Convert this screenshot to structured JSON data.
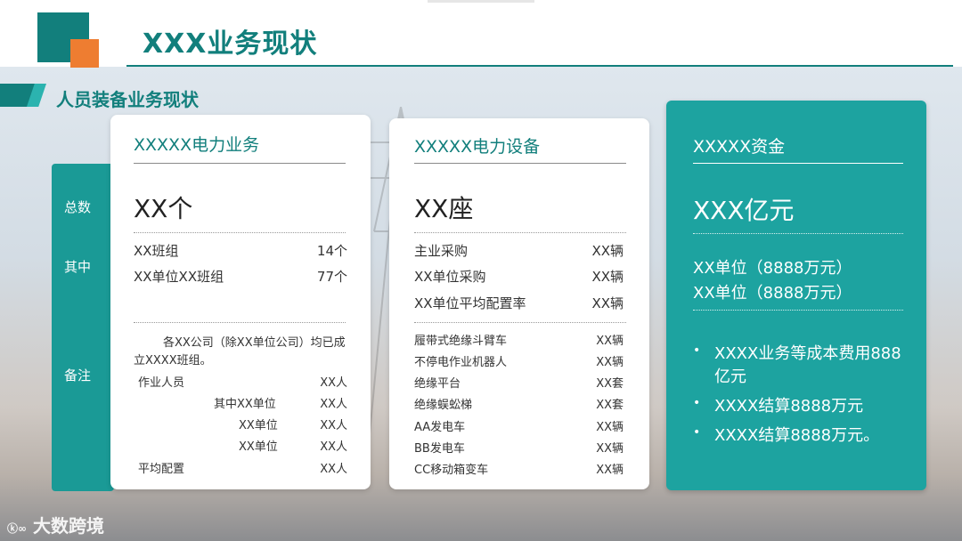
{
  "header": {
    "title": "XXX业务现状"
  },
  "section": {
    "title": "人员装备业务现状"
  },
  "side_labels": {
    "total": "总数",
    "among": "其中",
    "note": "备注"
  },
  "card1": {
    "heading": "XXXXX电力业务",
    "total": "XX个",
    "rows": [
      {
        "label": "XX班组",
        "value": "14个"
      },
      {
        "label": "XX单位XX班组",
        "value": "77个"
      }
    ],
    "note_text_line1": "各XX公司（除XX单位公司）均已成",
    "note_text_line2": "立XXXX班组。",
    "sub_rows": [
      {
        "label": "作业人员",
        "value": "XX人"
      },
      {
        "label": "其中XX单位",
        "value": "XX人"
      },
      {
        "label": "XX单位",
        "value": "XX人"
      },
      {
        "label": "XX单位",
        "value": "XX人"
      },
      {
        "label": "平均配置",
        "value": "XX人"
      }
    ]
  },
  "card2": {
    "heading": "XXXXX电力设备",
    "total": "XX座",
    "rows": [
      {
        "label": "主业采购",
        "value": "XX辆"
      },
      {
        "label": "XX单位采购",
        "value": "XX辆"
      },
      {
        "label": "XX单位平均配置率",
        "value": "XX辆"
      }
    ],
    "sub_rows": [
      {
        "label": "履带式绝缘斗臂车",
        "value": "XX辆"
      },
      {
        "label": "不停电作业机器人",
        "value": "XX辆"
      },
      {
        "label": "绝缘平台",
        "value": "XX套"
      },
      {
        "label": "绝缘蜈蚣梯",
        "value": "XX套"
      },
      {
        "label": "AA发电车",
        "value": "XX辆"
      },
      {
        "label": "BB发电车",
        "value": "XX辆"
      },
      {
        "label": "CC移动箱变车",
        "value": "XX辆"
      }
    ]
  },
  "card3": {
    "heading": "XXXXX资金",
    "total": "XXX亿元",
    "units": [
      "XX单位（8888万元）",
      "XX单位（8888万元）"
    ],
    "bullets": [
      "XXXX业务等成本费用888",
      "亿元",
      "XXXX结算8888万元",
      "XXXX结算8888万元。"
    ],
    "bullet_marker": "•"
  },
  "watermark": {
    "text": "大数跨境",
    "logo": "ⓚ∞"
  },
  "colors": {
    "primary": "#127f7c",
    "accent": "#ee7d31",
    "teal_card": "#1da3a0"
  }
}
